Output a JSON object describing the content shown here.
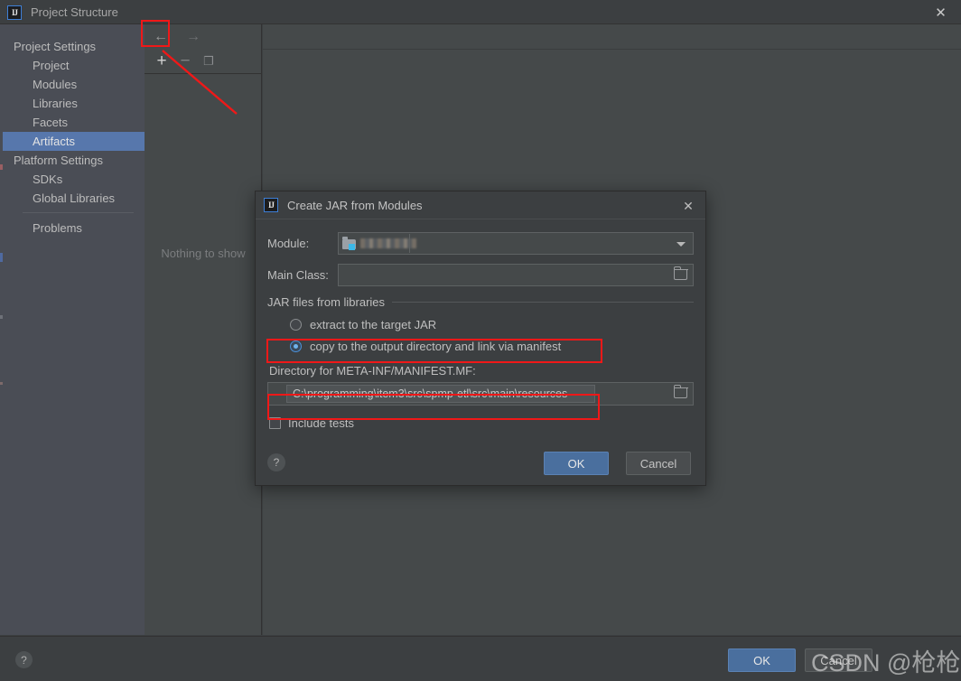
{
  "window": {
    "title": "Project Structure",
    "logo_text": "IJ",
    "close_icon": "✕"
  },
  "sidebar": {
    "sections": [
      {
        "label": "Project Settings",
        "type": "header"
      },
      {
        "label": "Project",
        "type": "child"
      },
      {
        "label": "Modules",
        "type": "child"
      },
      {
        "label": "Libraries",
        "type": "child"
      },
      {
        "label": "Facets",
        "type": "child"
      },
      {
        "label": "Artifacts",
        "type": "child",
        "selected": true
      },
      {
        "label": "Platform Settings",
        "type": "header"
      },
      {
        "label": "SDKs",
        "type": "child"
      },
      {
        "label": "Global Libraries",
        "type": "child"
      },
      {
        "label": "Problems",
        "type": "child"
      }
    ]
  },
  "nav": {
    "back_icon": "←",
    "forward_icon": "→"
  },
  "toolbar": {
    "add_label": "+",
    "remove_label": "−",
    "copy_label": "❐"
  },
  "artifacts_panel": {
    "empty_text": "Nothing to show"
  },
  "bottom": {
    "help_label": "?",
    "ok_label": "OK",
    "cancel_label": "Cancel"
  },
  "watermark": {
    "text": "CSDN @枪枪枪"
  },
  "dialog": {
    "logo_text": "IJ",
    "title": "Create JAR from Modules",
    "close_icon": "✕",
    "module_label": "Module:",
    "module_value": "",
    "main_class_label": "Main Class:",
    "main_class_value": "",
    "group_title": "JAR files from libraries",
    "radio_extract": "extract to the target JAR",
    "radio_copy": "copy to the output directory and link via manifest",
    "selected_radio": "copy",
    "manifest_label": "Directory for META-INF/MANIFEST.MF:",
    "manifest_path": "C:\\programming\\item3\\src\\spmp-etl\\src\\main\\resources",
    "include_tests_label": "Include tests",
    "include_tests_checked": false,
    "help_label": "?",
    "ok_label": "OK",
    "cancel_label": "Cancel"
  },
  "annotations": {
    "highlight_color": "#f01818",
    "boxes": [
      "add-button",
      "copy-radio-option",
      "manifest-path-field"
    ],
    "arrow": "from add-button pointing down-right"
  }
}
